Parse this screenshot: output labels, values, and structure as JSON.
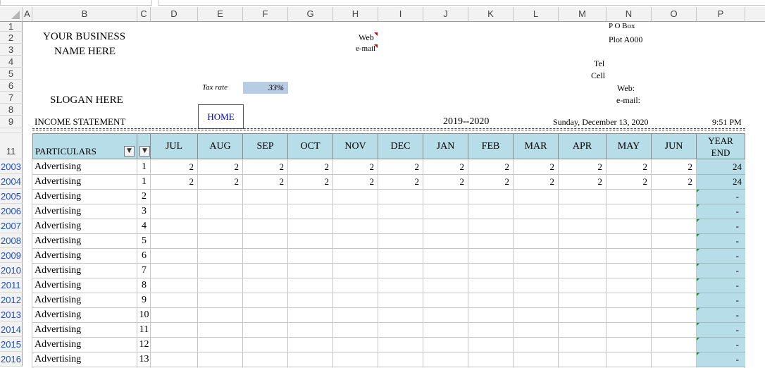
{
  "column_headers": [
    "A",
    "B",
    "C",
    "D",
    "E",
    "F",
    "G",
    "H",
    "I",
    "J",
    "K",
    "L",
    "M",
    "N",
    "O",
    "P"
  ],
  "top_rows": [
    "1",
    "2",
    "3",
    "4",
    "5",
    "6",
    "7",
    "8",
    "9"
  ],
  "header_row_number": "11",
  "business": {
    "name_line1": "YOUR BUSINESS",
    "name_line2": "NAME HERE",
    "slogan": "SLOGAN HERE",
    "statement_title": "INCOME STATEMENT",
    "tax_rate_label": "Tax rate",
    "tax_rate_value": "33%",
    "web_label": "Web",
    "email_label": "e-mail",
    "po_box": "P O Box",
    "plot": "Plot A000",
    "tel": "Tel",
    "cell": "Cell",
    "web2": "Web:",
    "email2": "e-mail:",
    "home_button": "HOME",
    "fiscal_year": "2019--2020",
    "date": "Sunday, December 13, 2020",
    "time": "9:51 PM"
  },
  "table": {
    "particulars_header": "PARTICULARS",
    "months": [
      "JUL",
      "AUG",
      "SEP",
      "OCT",
      "NOV",
      "DEC",
      "JAN",
      "FEB",
      "MAR",
      "APR",
      "MAY",
      "JUN"
    ],
    "year_end_line1": "YEAR",
    "year_end_line2": "END",
    "rows": [
      {
        "row": "2003",
        "label": "Advertising",
        "idx": "1",
        "values": [
          "2",
          "2",
          "2",
          "2",
          "2",
          "2",
          "2",
          "2",
          "2",
          "2",
          "2",
          "2"
        ],
        "total": "24"
      },
      {
        "row": "2004",
        "label": "Advertising",
        "idx": "1",
        "values": [
          "2",
          "2",
          "2",
          "2",
          "2",
          "2",
          "2",
          "2",
          "2",
          "2",
          "2",
          "2"
        ],
        "total": "24"
      },
      {
        "row": "2005",
        "label": "Advertising",
        "idx": "2",
        "values": [],
        "total": "-"
      },
      {
        "row": "2006",
        "label": "Advertising",
        "idx": "3",
        "values": [],
        "total": "-"
      },
      {
        "row": "2007",
        "label": "Advertising",
        "idx": "4",
        "values": [],
        "total": "-"
      },
      {
        "row": "2008",
        "label": "Advertising",
        "idx": "5",
        "values": [],
        "total": "-"
      },
      {
        "row": "2009",
        "label": "Advertising",
        "idx": "6",
        "values": [],
        "total": "-"
      },
      {
        "row": "2010",
        "label": "Advertising",
        "idx": "7",
        "values": [],
        "total": "-"
      },
      {
        "row": "2011",
        "label": "Advertising",
        "idx": "8",
        "values": [],
        "total": "-"
      },
      {
        "row": "2012",
        "label": "Advertising",
        "idx": "9",
        "values": [],
        "total": "-"
      },
      {
        "row": "2013",
        "label": "Advertising",
        "idx": "10",
        "values": [],
        "total": "-"
      },
      {
        "row": "2014",
        "label": "Advertising",
        "idx": "11",
        "values": [],
        "total": "-"
      },
      {
        "row": "2015",
        "label": "Advertising",
        "idx": "12",
        "values": [],
        "total": "-"
      },
      {
        "row": "2016",
        "label": "Advertising",
        "idx": "13",
        "values": [],
        "total": "-"
      }
    ]
  },
  "colors": {
    "header_fill": "#b7dde8",
    "tax_fill": "#b8cce4",
    "row_number_blue": "#1f4fbf",
    "home_text": "#0000cc"
  }
}
